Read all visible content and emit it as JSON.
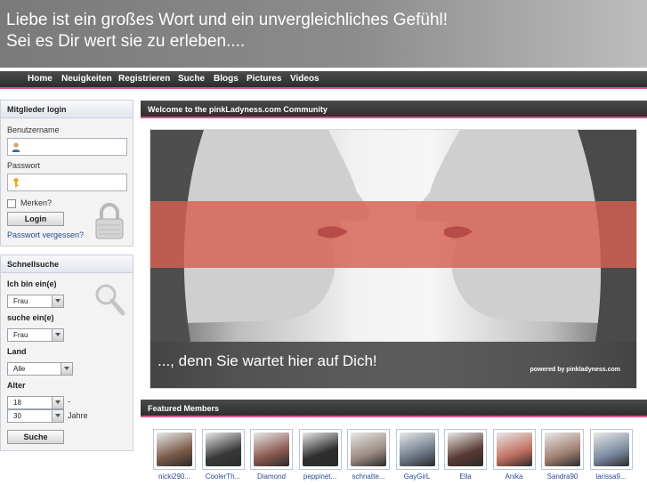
{
  "header": {
    "line1": "Liebe ist ein großes Wort und ein unvergleichliches Gefühl!",
    "line2": "Sei es Dir wert sie zu erleben...."
  },
  "nav": [
    "Home",
    "Neuigkeiten",
    "Registrieren",
    "Suche",
    "Blogs",
    "Pictures",
    "Videos"
  ],
  "login": {
    "title": "Mitglieder login",
    "username_label": "Benutzername",
    "password_label": "Passwort",
    "remember_label": "Merken?",
    "login_button": "Login",
    "forgot_link": "Passwort vergessen?"
  },
  "search": {
    "title": "Schnellsuche",
    "iam_label": "Ich bin ein(e)",
    "iam_value": "Frau",
    "seek_label": "suche ein(e)",
    "seek_value": "Frau",
    "country_label": "Land",
    "country_value": "Alle",
    "age_label": "Alter",
    "age_from": "18",
    "age_dash": "-",
    "age_to": "30",
    "age_unit": "Jahre",
    "search_button": "Suche"
  },
  "welcome": {
    "title": "Welcome to the pinkLadyness.com Community",
    "tagline": "..., denn Sie wartet hier auf Dich!",
    "powered": "powered by pinkladyness.com"
  },
  "featured": {
    "title": "Featured Members",
    "members": [
      {
        "name": "nicki290...",
        "color": "#7a5a48"
      },
      {
        "name": "CoolerTh...",
        "color": "#3a3a3a"
      },
      {
        "name": "Diamond",
        "color": "#8a5a50"
      },
      {
        "name": "peppinet...",
        "color": "#2e2e2e"
      },
      {
        "name": "schnatte...",
        "color": "#9a8a82"
      },
      {
        "name": "GayGirL",
        "color": "#6e7a88"
      },
      {
        "name": "Ella",
        "color": "#5a3a32"
      },
      {
        "name": "Anika",
        "color": "#c07060"
      },
      {
        "name": "Sandra90",
        "color": "#a08070"
      },
      {
        "name": "larissa9...",
        "color": "#7a8aa0"
      }
    ]
  },
  "colors": {
    "accent": "#d9568f",
    "link": "#2c4a8f",
    "header_bg": "#8c8c8c",
    "band": "#d46050"
  }
}
